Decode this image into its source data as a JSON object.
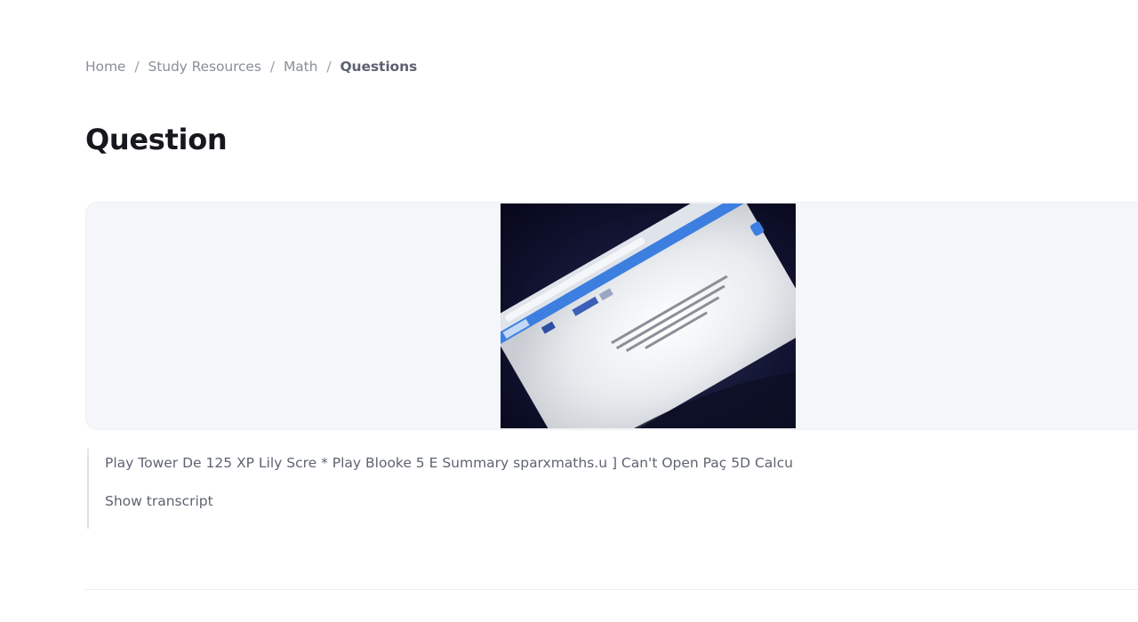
{
  "breadcrumb": {
    "items": [
      "Home",
      "Study Resources",
      "Math"
    ],
    "current": "Questions",
    "separator": "/"
  },
  "page_title": "Question",
  "photo": {
    "description_icon": "photo-of-laptop-screen"
  },
  "transcript": {
    "text": "Play Tower De 125 XP Lily Scre * Play Blooke 5 E Summary sparxmaths.u ] Can't Open Paç 5D Calcu",
    "toggle_label": "Show transcript"
  },
  "colors": {
    "card_bg": "#f4f6fa",
    "title": "#16181d",
    "muted_text": "#5e6470",
    "breadcrumb": "#8a8f98",
    "accent_blue": "#3d7fe0"
  }
}
